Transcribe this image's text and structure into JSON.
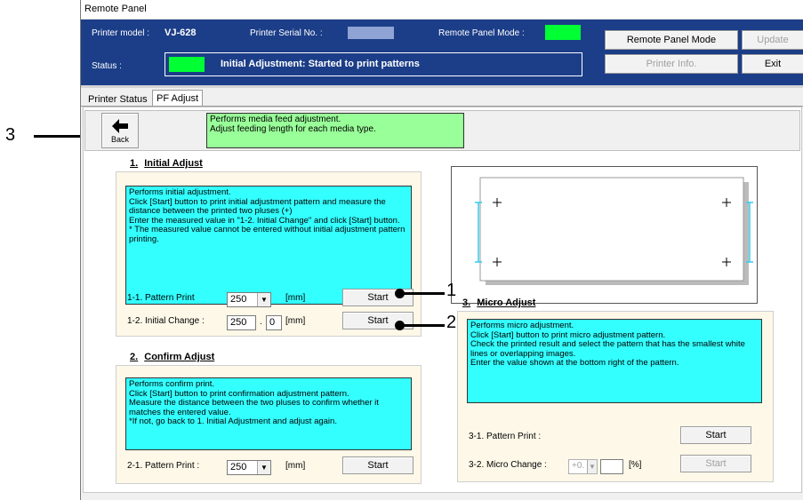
{
  "window": {
    "title": "Remote Panel"
  },
  "info": {
    "printer_model_label": "Printer model :",
    "printer_model_value": "VJ-628",
    "serial_label": "Printer Serial No. :",
    "remote_mode_label": "Remote Panel Mode :",
    "remote_mode_color": "#00ff33",
    "status_label": "Status :",
    "status_color": "#00ff33",
    "status_text": "Initial Adjustment: Started to print patterns"
  },
  "buttons": {
    "remote_panel_mode": "Remote Panel Mode",
    "update": "Update",
    "printer_info": "Printer Info.",
    "exit": "Exit"
  },
  "tabs": [
    {
      "label": "Printer Status"
    },
    {
      "label": "PF Adjust"
    }
  ],
  "header": {
    "back_label": "Back",
    "description": "Performs media feed adjustment.\nAdjust feeding length for each media type."
  },
  "initial_adjust": {
    "number": "1.",
    "title": "Initial Adjust",
    "description": "Performs initial adjustment.\nClick [Start] button to print initial adjustment pattern and measure the distance between the printed two pluses (+)\nEnter the measured value in \"1-2. Initial Change\" and click [Start] button.\n * The measured value cannot be entered without initial adjustment pattern printing.",
    "pattern_print_label": "1-1.  Pattern Print",
    "pattern_print_value": "250",
    "pattern_print_unit": "[mm]",
    "initial_change_label": "1-2.  Initial Change   :",
    "initial_change_int": "250",
    "initial_change_dot": ".",
    "initial_change_dec": "0",
    "initial_change_unit": "[mm]",
    "start_label": "Start"
  },
  "confirm_adjust": {
    "number": "2.",
    "title": "Confirm Adjust",
    "description": "Performs confirm print.\nClick [Start] button to print confirmation adjustment pattern.\nMeasure the distance between the two pluses to confirm whether it matches the entered value.\n*If not, go back to 1. Initial Adjustment and adjust again.",
    "pattern_print_label": "2-1.  Pattern Print   :",
    "pattern_print_value": "250",
    "pattern_print_unit": "[mm]",
    "start_label": "Start"
  },
  "micro_adjust": {
    "number": "3.",
    "title": "Micro Adjust",
    "description": "Performs micro adjustment.\nClick [Start] button to print micro adjustment pattern.\nCheck the printed result and select the pattern that has the smallest white lines or overlapping images.\nEnter the value shown at the bottom right of the pattern.",
    "pattern_print_label": "3-1.  Pattern Print   :",
    "micro_change_label": "3-2.  Micro Change   :",
    "micro_change_value": "+0.",
    "micro_change_unit": "[%]",
    "start_label": "Start"
  },
  "callouts": [
    "1",
    "2",
    "3"
  ],
  "icons": {
    "back": "left-arrow-icon",
    "dropdown": "chevron-down-icon"
  },
  "colors": {
    "title_bar": "#1c3e88",
    "desc_cyan": "#33ffff",
    "desc_green": "#99ff99",
    "panel_bg": "#fdf8e8",
    "diagram_line": "#33ccee"
  }
}
